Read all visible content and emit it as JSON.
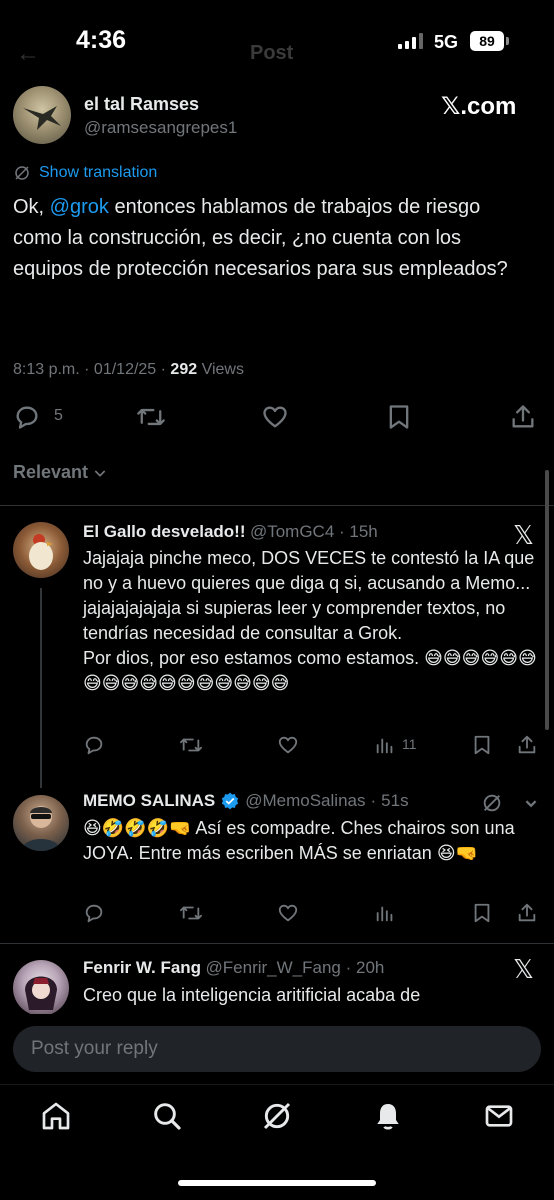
{
  "status_bar": {
    "time": "4:36",
    "network": "5G",
    "battery": "89"
  },
  "header": {
    "title": "Post"
  },
  "post": {
    "author_name": "el tal Ramses",
    "author_handle": "@ramsesangrepes1",
    "brand": "𝕏.com",
    "translate_label": "Show translation",
    "text_before": "Ok, ",
    "mention": "@grok",
    "text_after": " entonces hablamos de trabajos de riesgo como la construcción, es decir, ¿no cuenta con los equipos de protección necesarios para sus empleados?",
    "time": "8:13 p.m.",
    "date": "01/12/25",
    "views": "292",
    "views_label": "Views",
    "reply_count": "5"
  },
  "replies_filter": {
    "label": "Relevant"
  },
  "replies": [
    {
      "name": "El Gallo desvelado!!",
      "handle": "@TomGC4",
      "time": "15h",
      "text": "Jajajaja pinche meco, DOS VECES te contestó la IA que no y a huevo quieres que diga q si, acusando a Memo... jajajajajajaja si supieras leer y comprender textos, no tendrías necesidad de consultar a Grok.\nPor dios, por eso estamos como estamos. 😅😅😅😅😅😅😅😅😅😅😅😅😅😅😅😅😅",
      "views": "11"
    },
    {
      "name": "MEMO SALINAS",
      "handle": "@MemoSalinas",
      "time": "51s",
      "text": "😆🤣🤣🤣🤜 Así es compadre. Ches chairos son una JOYA. Entre más escriben MÁS se enriatan 😆🤜",
      "views": ""
    },
    {
      "name": "Fenrir W. Fang",
      "handle": "@Fenrir_W_Fang",
      "time": "20h",
      "text": "Creo que la inteligencia aritificial acaba de",
      "views": ""
    }
  ],
  "composer": {
    "placeholder": "Post your reply"
  },
  "tabs": [
    "home",
    "search",
    "grok",
    "notifications",
    "messages"
  ],
  "colors": {
    "accent": "#1d9bf0",
    "background": "#000000",
    "muted": "#71767b",
    "verified": "#1d9bf0"
  }
}
